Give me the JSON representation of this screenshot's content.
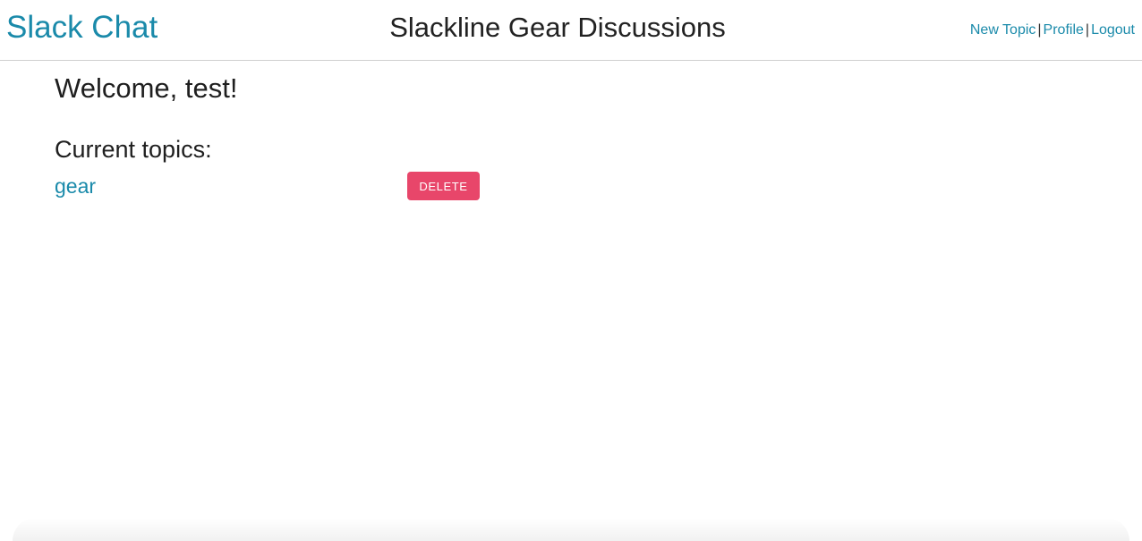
{
  "header": {
    "brand": "Slack Chat",
    "title": "Slackline Gear Discussions",
    "nav": {
      "new_topic": "New Topic",
      "separator": "|",
      "profile": "Profile",
      "logout": "Logout"
    }
  },
  "main": {
    "welcome": "Welcome, test!",
    "topics_heading": "Current topics:",
    "topics": [
      {
        "name": "gear",
        "delete_label": "DELETE"
      }
    ]
  },
  "colors": {
    "link": "#1a8aaa",
    "delete_button": "#e8466a",
    "text": "#1f1f1f"
  }
}
